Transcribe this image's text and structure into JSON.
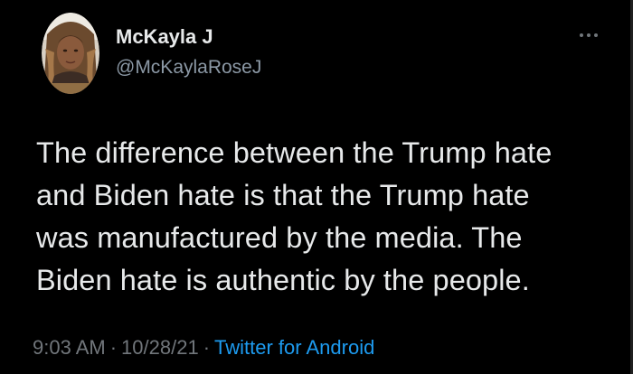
{
  "user": {
    "display_name": "McKayla J",
    "handle": "@McKaylaRoseJ",
    "avatar_icon": "profile-photo"
  },
  "tweet": {
    "text": "The difference between the Trump hate\nand Biden hate is that the Trump hate\nwas manufactured by the media. The\nBiden hate is authentic by the people.",
    "time": "9:03 AM",
    "date": "10/28/21",
    "separator": "·",
    "source": "Twitter for Android"
  },
  "colors": {
    "background": "#000000",
    "primary_text": "#e7e9ea",
    "secondary_text": "#71767b",
    "link": "#1d9bf0"
  },
  "icons": {
    "more": "more-options-icon"
  }
}
